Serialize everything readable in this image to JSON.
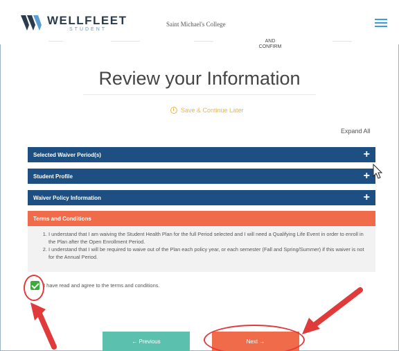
{
  "header": {
    "brand": "WELLFLEET",
    "brand_sub": "STUDENT",
    "college": "Saint Michael's College"
  },
  "steps": {
    "active": "AND\nCONFIRM"
  },
  "page": {
    "title": "Review your Information",
    "save_later": "Save & Continue Later",
    "expand_all": "Expand All"
  },
  "sections": [
    {
      "label": "Selected Waiver Period(s)"
    },
    {
      "label": "Student Profile"
    },
    {
      "label": "Waiver Policy Information"
    },
    {
      "label": "Terms and Conditions"
    }
  ],
  "terms": [
    "I understand that I am waiving the Student Health Plan for the full Period selected and I will need a Qualifying Life Event in order to enroll in the Plan after the Open Enrollment Period.",
    "I understand that I will be required to waive out of the Plan each policy year, or each semester (Fall and Spring/Summer) if this waiver is not for the Annual Period."
  ],
  "agree": {
    "label": "I have read and agree to the terms and conditions.",
    "checked": true
  },
  "buttons": {
    "previous": "← Previous",
    "next": "Next →"
  },
  "colors": {
    "navy": "#1d4f82",
    "coral": "#ef6b4a",
    "teal": "#5bc0ad",
    "annotation_red": "#e03a3a"
  }
}
